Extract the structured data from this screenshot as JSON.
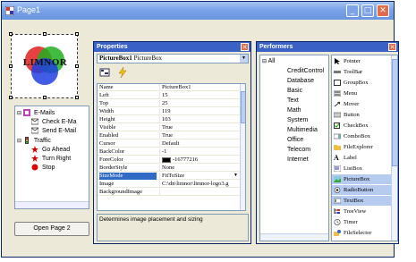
{
  "window": {
    "title": "Page1",
    "buttons": {
      "minimize": "_",
      "maximize": "□",
      "close": "✕"
    },
    "titlebar_color": "#7aa3e8"
  },
  "designer": {
    "logo_text": "LIMNOR",
    "tree_items": [
      {
        "label": "E-Mails",
        "icon": "mail-icon",
        "level": 0
      },
      {
        "label": "Check E-Ma",
        "icon": "envelope-icon",
        "level": 1
      },
      {
        "label": "Send E-Mail",
        "icon": "envelope-icon",
        "level": 1
      },
      {
        "label": "Traffic",
        "icon": "traffic-light-icon",
        "level": 0
      },
      {
        "label": "Go Ahead",
        "icon": "star-icon",
        "level": 1
      },
      {
        "label": "Turn Right",
        "icon": "star-icon",
        "level": 1
      },
      {
        "label": "Stop",
        "icon": "stop-icon",
        "level": 1
      }
    ],
    "open_button": "Open Page 2"
  },
  "properties": {
    "title": "Properties",
    "close": "✕",
    "object_name": "PictureBox1",
    "object_type": "PictureBox",
    "rows": [
      {
        "name": "Name",
        "value": "PictureBox1"
      },
      {
        "name": "Left",
        "value": "15"
      },
      {
        "name": "Top",
        "value": "25"
      },
      {
        "name": "Width",
        "value": "119"
      },
      {
        "name": "Height",
        "value": "103"
      },
      {
        "name": "Visible",
        "value": "True"
      },
      {
        "name": "Enabled",
        "value": "True"
      },
      {
        "name": "Cursor",
        "value": "Default"
      },
      {
        "name": "BackColor",
        "value": "-1"
      },
      {
        "name": "ForeColor",
        "value": "-16777216",
        "swatch": "#000000"
      },
      {
        "name": "BorderStyle",
        "value": "None"
      },
      {
        "name": "SizeMode",
        "value": "FitToSize",
        "selected": true
      },
      {
        "name": "Image",
        "value": "C:\\dn\\limnor\\limnor-logo3.g"
      },
      {
        "name": "BackgroundImage",
        "value": ""
      }
    ],
    "description": "Determines image placement and sizing"
  },
  "performers": {
    "title": "Performers",
    "close": "✕",
    "categories": [
      "All",
      "CreditControl",
      "Database",
      "Basic",
      "Text",
      "Math",
      "System",
      "Multimedia",
      "Office",
      "Telecom",
      "Internet"
    ],
    "tools": [
      {
        "label": "Pointer",
        "icon": "pointer-icon"
      },
      {
        "label": "ToolBar",
        "icon": "toolbar-icon"
      },
      {
        "label": "GroupBox",
        "icon": "groupbox-icon"
      },
      {
        "label": "Menu",
        "icon": "menu-icon"
      },
      {
        "label": "Mover",
        "icon": "mover-icon"
      },
      {
        "label": "Button",
        "icon": "button-icon"
      },
      {
        "label": "CheckBox",
        "icon": "checkbox-icon"
      },
      {
        "label": "ComboBox",
        "icon": "combobox-icon"
      },
      {
        "label": "FileExplorer",
        "icon": "folder-icon"
      },
      {
        "label": "Label",
        "icon": "label-icon"
      },
      {
        "label": "ListBox",
        "icon": "listbox-icon"
      },
      {
        "label": "PictureBox",
        "icon": "picture-icon",
        "highlight": true
      },
      {
        "label": "RadioButton",
        "icon": "radio-icon",
        "highlight": true
      },
      {
        "label": "TextBox",
        "icon": "textbox-icon",
        "highlight": true
      },
      {
        "label": "TreeView",
        "icon": "treeview-icon"
      },
      {
        "label": "Timer",
        "icon": "timer-icon"
      },
      {
        "label": "FileSelector",
        "icon": "fileselector-icon"
      }
    ]
  }
}
